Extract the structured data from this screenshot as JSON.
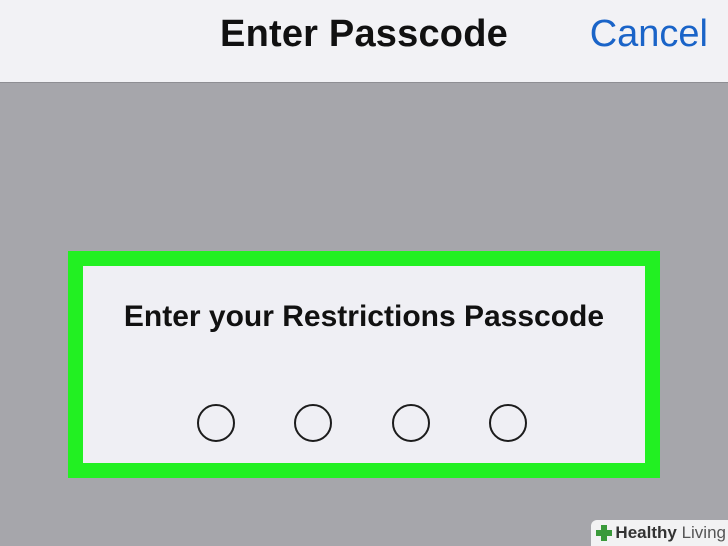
{
  "navbar": {
    "title": "Enter Passcode",
    "cancel_label": "Cancel"
  },
  "passcode": {
    "prompt": "Enter your Restrictions Passcode",
    "digits_total": 4,
    "digits_entered": 0
  },
  "colors": {
    "accent": "#1a64c8",
    "highlight": "#22f022",
    "backdrop": "#a6a6ab"
  },
  "watermark": {
    "bold": "Healthy",
    "light": "Living"
  }
}
